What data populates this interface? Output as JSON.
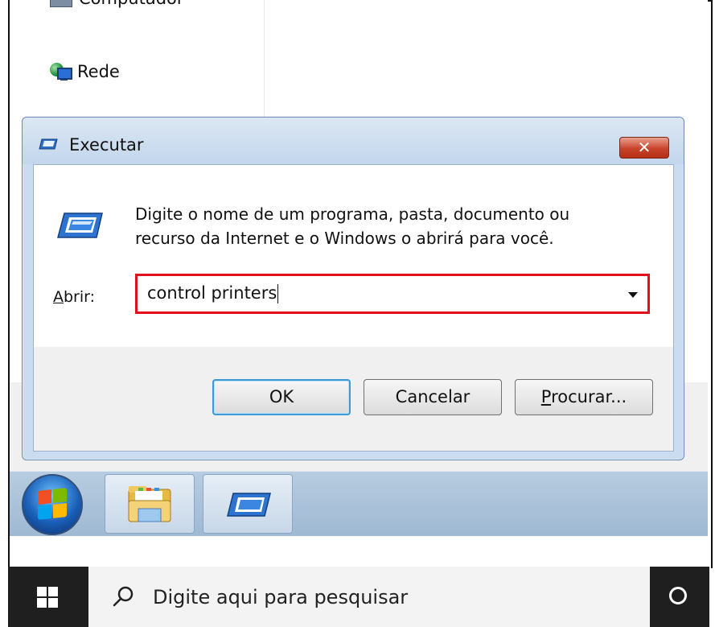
{
  "explorer": {
    "nav_items": [
      {
        "label": "Computador",
        "icon": "computer-icon"
      },
      {
        "label": "Rede",
        "icon": "network-icon"
      }
    ]
  },
  "run_dialog": {
    "title": "Executar",
    "close_label": "✕",
    "description": "Digite o nome de um programa, pasta, documento ou recurso da Internet e o Windows o abrirá para você.",
    "open_label_first": "A",
    "open_label_rest": "brir:",
    "input_value": "control printers",
    "buttons": {
      "ok": "OK",
      "cancel": "Cancelar",
      "browse_first": "P",
      "browse_rest": "rocurar..."
    },
    "highlight_color": "#e0101e"
  },
  "taskbar_win7": {
    "items": [
      "start-orb",
      "windows-explorer-icon",
      "run-icon"
    ]
  },
  "taskbar_win10": {
    "search_placeholder": "Digite aqui para pesquisar",
    "icons": [
      "windows-start-icon",
      "search-icon",
      "cortana-icon"
    ]
  }
}
